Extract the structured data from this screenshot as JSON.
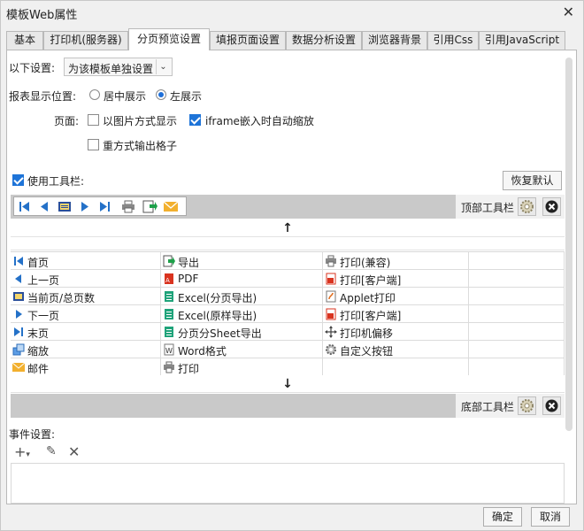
{
  "window": {
    "title": "模板Web属性"
  },
  "tabs": [
    {
      "label": "基本"
    },
    {
      "label": "打印机(服务器)"
    },
    {
      "label": "分页预览设置"
    },
    {
      "label": "填报页面设置"
    },
    {
      "label": "数据分析设置"
    },
    {
      "label": "浏览器背景"
    },
    {
      "label": "引用Css"
    },
    {
      "label": "引用JavaScript"
    }
  ],
  "settings": {
    "scope_label": "以下设置:",
    "scope_value": "为该模板单独设置",
    "position_label": "报表显示位置:",
    "position_options": [
      "居中展示",
      "左展示"
    ],
    "page_label": "页面:",
    "opt_image": "以图片方式显示",
    "opt_iframe": "iframe嵌入时自动缩放",
    "opt_grid": "重方式输出格子"
  },
  "toolbar": {
    "use_label": "使用工具栏:",
    "restore_label": "恢复默认",
    "top_label": "顶部工具栏",
    "bottom_label": "底部工具栏"
  },
  "buttons": {
    "col1": [
      "首页",
      "上一页",
      "当前页/总页数",
      "下一页",
      "末页",
      "缩放",
      "邮件"
    ],
    "col2": [
      "导出",
      "PDF",
      "Excel(分页导出)",
      "Excel(原样导出)",
      "分页分Sheet导出",
      "Word格式",
      "打印"
    ],
    "col3": [
      "打印(兼容)",
      "打印[客户端]",
      "Applet打印",
      "打印[客户端]",
      "打印机偏移",
      "自定义按钮"
    ]
  },
  "events": {
    "label": "事件设置:"
  },
  "footer": {
    "ok": "确定",
    "cancel": "取消"
  },
  "colors": {
    "accent": "#1e74d8",
    "strip": "#c9c9c9"
  }
}
